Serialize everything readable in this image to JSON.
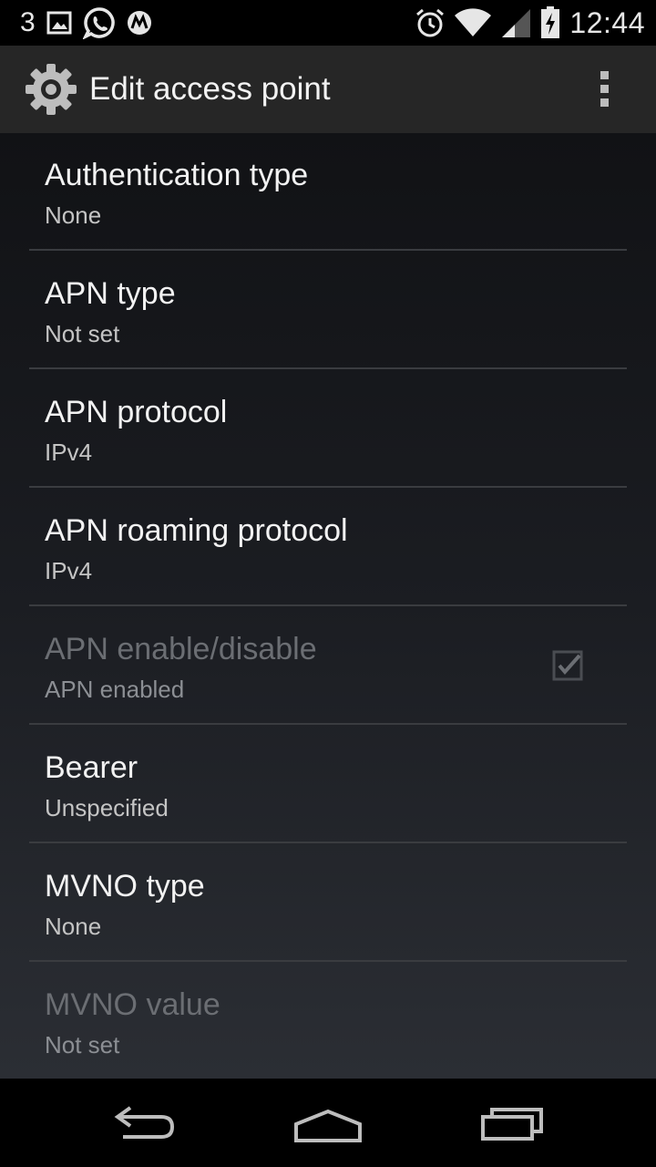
{
  "status_bar": {
    "notification_count": "3",
    "time": "12:44",
    "icons": [
      "image-icon",
      "whatsapp-icon",
      "motorola-icon",
      "alarm-icon",
      "wifi-icon",
      "cell-signal-icon",
      "battery-charging-icon"
    ]
  },
  "action_bar": {
    "title": "Edit access point",
    "icon": "settings-gear-icon",
    "overflow_icon": "overflow-menu-icon"
  },
  "preferences": [
    {
      "title": "Authentication type",
      "summary": "None",
      "enabled": true
    },
    {
      "title": "APN type",
      "summary": "Not set",
      "enabled": true
    },
    {
      "title": "APN protocol",
      "summary": "IPv4",
      "enabled": true
    },
    {
      "title": "APN roaming protocol",
      "summary": "IPv4",
      "enabled": true
    },
    {
      "title": "APN enable/disable",
      "summary": "APN enabled",
      "enabled": false,
      "checked": true
    },
    {
      "title": "Bearer",
      "summary": "Unspecified",
      "enabled": true
    },
    {
      "title": "MVNO type",
      "summary": "None",
      "enabled": true
    },
    {
      "title": "MVNO value",
      "summary": "Not set",
      "enabled": false
    }
  ],
  "navigation": {
    "icons": [
      "back-icon",
      "home-icon",
      "recent-apps-icon"
    ]
  },
  "colors": {
    "action_bar": "#262626",
    "status_bar": "#000000",
    "text_primary": "#f2f2f2",
    "text_disabled": "#6b6e73"
  }
}
